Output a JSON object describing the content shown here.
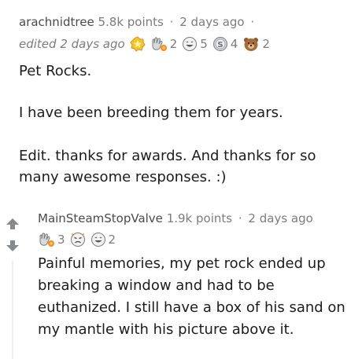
{
  "comment": {
    "username": "arachnidtree",
    "points": "5.8k points",
    "time": "2 days ago",
    "edited": "edited 2 days ago",
    "awards": [
      {
        "icon": "gold-star-award-icon",
        "count": ""
      },
      {
        "icon": "wholesome-hand-award-icon",
        "count": "2"
      },
      {
        "icon": "haha-face-award-icon",
        "count": "5"
      },
      {
        "icon": "silver-coin-award-icon",
        "count": "4"
      },
      {
        "icon": "bear-hug-award-icon",
        "count": "2"
      }
    ],
    "paragraphs": [
      "Pet Rocks.",
      "I have been breeding them for years.",
      "Edit. thanks for awards. And thanks for so many awesome responses. :)"
    ]
  },
  "reply": {
    "username": "MainSteamStopValve",
    "points": "1.9k points",
    "time": "2 days ago",
    "awards": [
      {
        "icon": "wholesome-hand-award-icon",
        "count": "3"
      },
      {
        "icon": "crying-face-award-icon",
        "count": ""
      },
      {
        "icon": "haha-face-award-icon",
        "count": "2"
      }
    ],
    "body": "Painful memories, my pet rock ended up breaking a window and had to be euthanized. I still have a box of his sand on my mantle with his picture above it.",
    "vote_color": "#878a8c"
  }
}
